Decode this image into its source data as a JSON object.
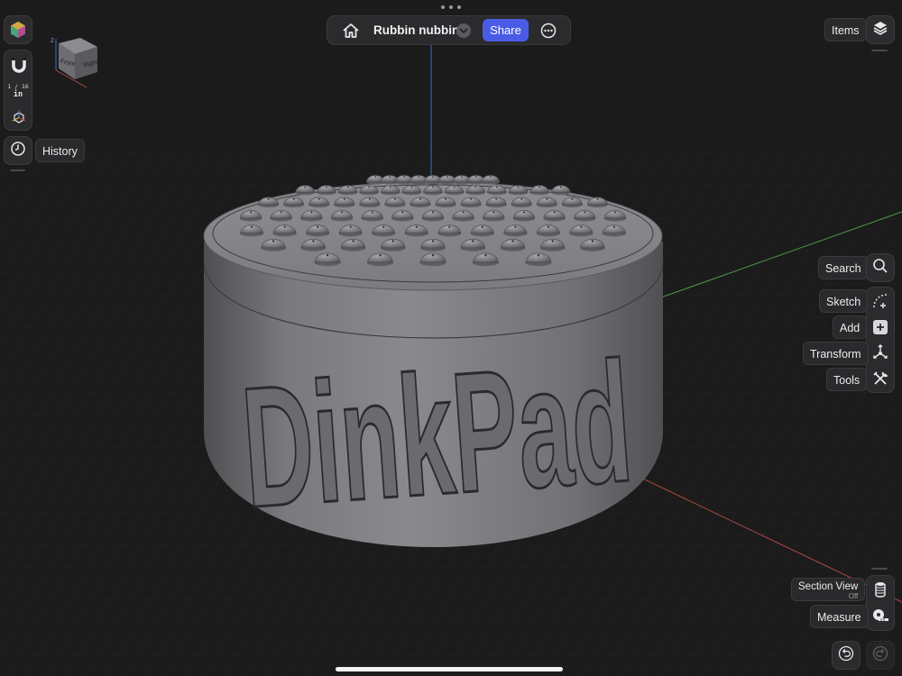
{
  "document": {
    "title": "Rubbin nubbin",
    "share_label": "Share"
  },
  "left_toolbar": {
    "grid_unit_fraction": "1 / 16",
    "grid_unit_name": "in",
    "history_label": "History"
  },
  "view_cube": {
    "front_label": "Front",
    "right_label": "Right",
    "axis_z_label": "Z"
  },
  "right_toolbar": {
    "items_label": "Items",
    "search_label": "Search",
    "sketch_label": "Sketch",
    "add_label": "Add",
    "transform_label": "Transform",
    "tools_label": "Tools",
    "section_view_label": "Section View",
    "section_view_state": "Off",
    "measure_label": "Measure"
  },
  "model": {
    "embossed_text": "DinkPad",
    "body_color": "#78787c"
  },
  "colors": {
    "background": "#1b1b1c",
    "share_button": "#4a5ce6",
    "axis_x": "#b4483f",
    "axis_y": "#4e9a46",
    "axis_z": "#3f6fc4"
  }
}
